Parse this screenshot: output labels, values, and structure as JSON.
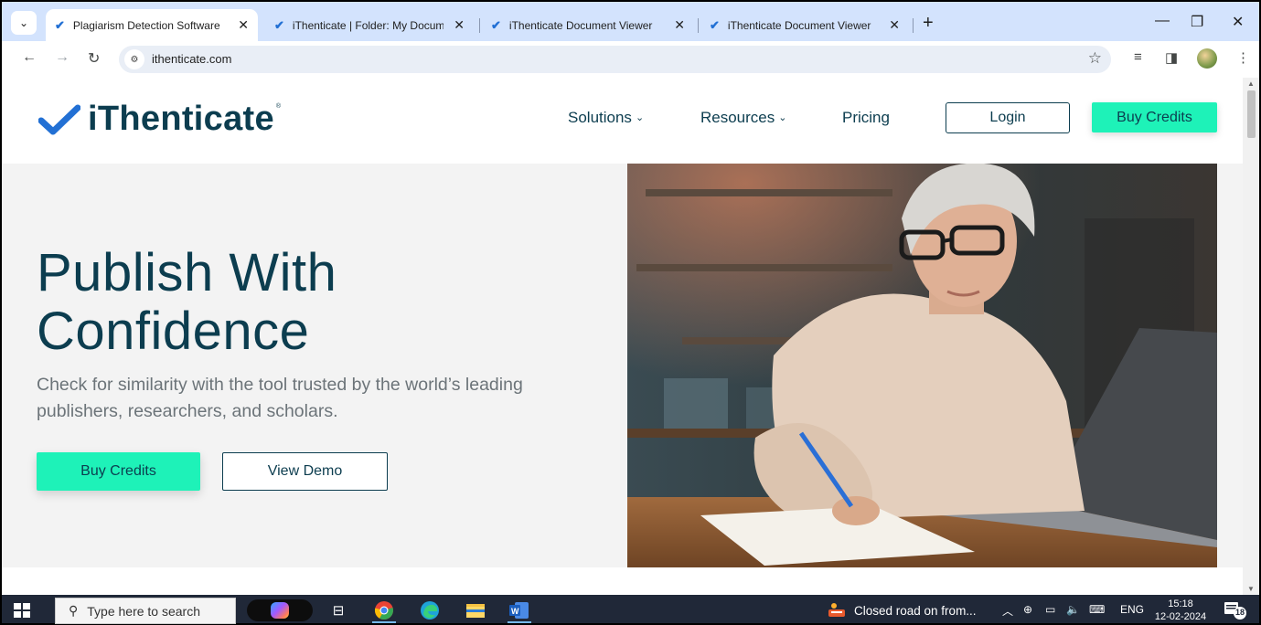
{
  "browser": {
    "tabs": [
      {
        "title": "Plagiarism Detection Software |",
        "active": true
      },
      {
        "title": "iThenticate | Folder: My Docum",
        "active": false
      },
      {
        "title": "iThenticate Document Viewer",
        "active": false
      },
      {
        "title": "iThenticate Document Viewer",
        "active": false
      }
    ],
    "new_tab": "+",
    "address": "ithenticate.com",
    "window_controls": {
      "minimize": "—",
      "restore": "❐",
      "close": "✕"
    }
  },
  "site": {
    "logo_text": "iThenticate",
    "logo_mark": "®",
    "nav": {
      "solutions": "Solutions",
      "resources": "Resources",
      "pricing": "Pricing"
    },
    "login_label": "Login",
    "buy_credits_label": "Buy Credits",
    "brand_color": "#0c3d4f",
    "accent_color": "#1ef2b8"
  },
  "hero": {
    "title": "Publish With Confidence",
    "subtitle": "Check for similarity with the tool trusted by the world’s leading publishers, researchers, and scholars.",
    "primary_cta": "Buy Credits",
    "secondary_cta": "View Demo"
  },
  "taskbar": {
    "search_placeholder": "Type here to search",
    "notification": "Closed road on from...",
    "language": "ENG",
    "time": "15:18",
    "date": "12-02-2024",
    "notification_count": "18"
  }
}
